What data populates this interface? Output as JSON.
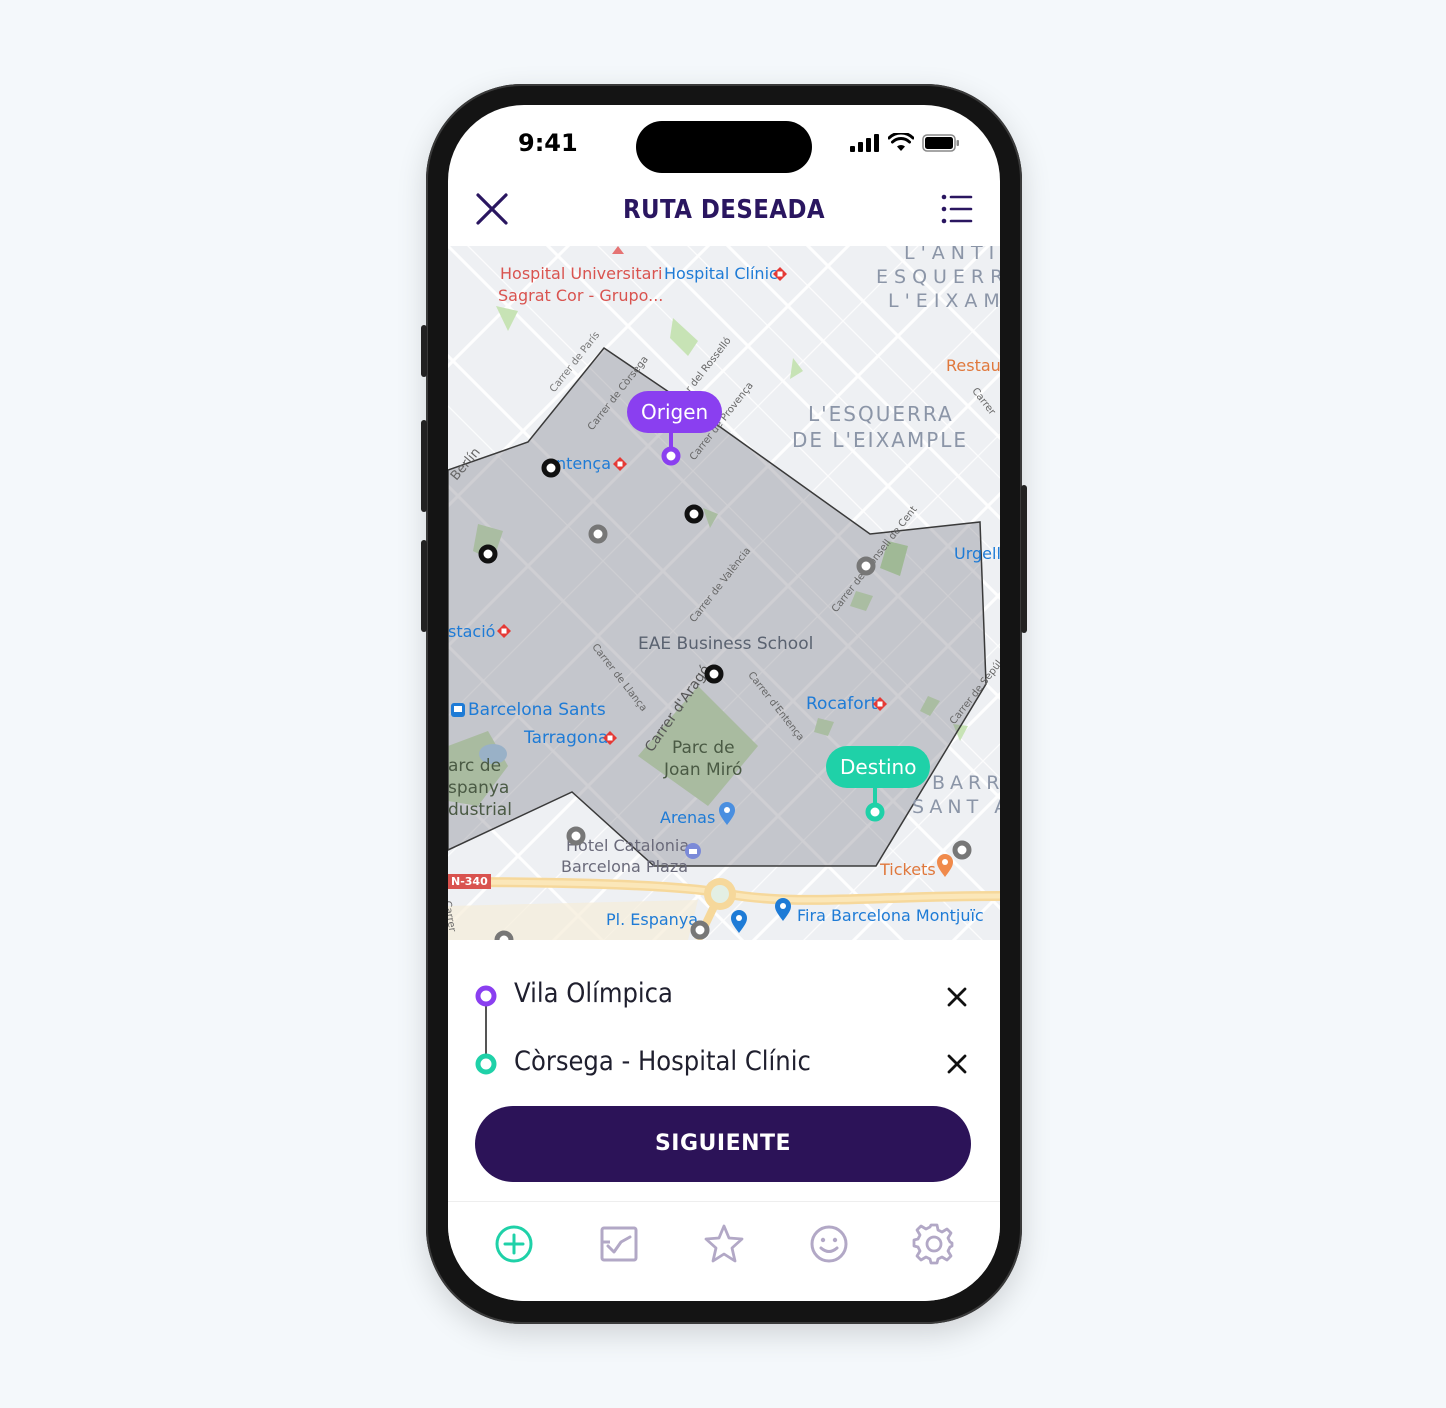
{
  "status": {
    "time": "9:41"
  },
  "header": {
    "title": "RUTA DESEADA"
  },
  "map": {
    "labels": {
      "hospital_universitari": "Hospital Universitari",
      "sagrat_cor": "Sagrat Cor - Grupo...",
      "hospital_clinic": "Hospital Clínic",
      "lantiga_1": "L'ANTIG",
      "lantiga_2": "ESQUERRA",
      "lantiga_3": "L'EIXAMP",
      "restau": "Restau",
      "lesquerra_1": "L'ESQUERRA",
      "lesquerra_2": "DE L'EIXAMPLE",
      "entenca": "ntença",
      "berlin": "Berlín",
      "urgell": "Urgell",
      "estacio": "stació",
      "eae": "EAE Business School",
      "rocafort": "Rocafort",
      "barcelona_sants": "Barcelona Sants",
      "tarragona": "Tarragona",
      "parc_miro_1": "Parc de",
      "parc_miro_2": "Joan Miró",
      "parc_espanya_1": "arc de",
      "parc_espanya_2": "spanya",
      "parc_espanya_3": "dustrial",
      "arenas": "Arenas",
      "barri_1": "BARRI",
      "barri_2": "SANT A",
      "hotel_1": "Hotel Catalonia",
      "hotel_2": "Barcelona Plaza",
      "tickets": "Tickets",
      "n340": "N-340",
      "pl_espanya": "Pl. Espanya",
      "fira": "Fira Barcelona Montjuïc",
      "carrer_paris": "Carrer de París",
      "carrer_corsega": "Carrer de Còrsega",
      "carrer_rossello": "r del Rosselló",
      "carrer_provenca": "Carrer de Provença",
      "carrer_valencia": "Carrer de València",
      "carrer_llanca": "Carrer de Llança",
      "carrer_arago": "Carrer d'Aragó",
      "carrer_entenca": "Carrer d'Entença",
      "carrer_consell": "Carrer del Consell de Cent",
      "carrer_sepul": "Carrer de Sepúl",
      "carrer_side": "Carrer",
      "carrer_right": "Carrer"
    },
    "origin_label": "Origen",
    "destination_label": "Destino"
  },
  "route": {
    "origin": "Vila Olímpica",
    "destination": "Còrsega - Hospital Clínic",
    "next_label": "SIGUIENTE"
  },
  "colors": {
    "origin": "#8a3ff0",
    "destination": "#1fd1a8",
    "primary": "#2c1358"
  }
}
